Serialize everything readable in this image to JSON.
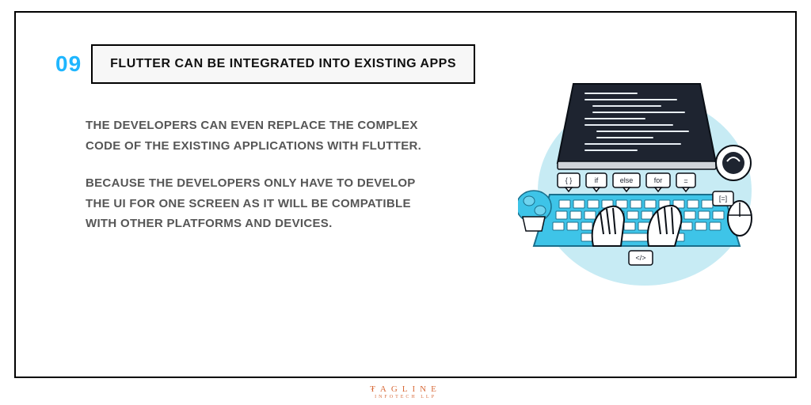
{
  "slide": {
    "number": "09",
    "title": "FLUTTER CAN BE INTEGRATED INTO EXISTING APPS",
    "para1": "THE DEVELOPERS CAN EVEN REPLACE THE COMPLEX CODE OF THE EXISTING APPLICATIONS WITH FLUTTER.",
    "para2": "BECAUSE THE DEVELOPERS ONLY HAVE TO DEVELOP THE UI FOR ONE SCREEN AS IT WILL BE COMPATIBLE WITH OTHER PLATFORMS AND DEVICES."
  },
  "illustration": {
    "bubble_if": "if",
    "bubble_else": "else",
    "bubble_for": "for",
    "bubble_eq": "=",
    "bubble_braces": "{ }",
    "bubble_square": "[=]",
    "bubble_tag": "</>"
  },
  "footer": {
    "brand": "₮AGLINE",
    "sub": "INFOTECH LLP"
  },
  "colors": {
    "accent": "#1fb6ff",
    "brand": "#d86b3a",
    "bg_blob": "#c7ebf4",
    "keyboard": "#3ec4e8",
    "screen": "#1e2430"
  }
}
